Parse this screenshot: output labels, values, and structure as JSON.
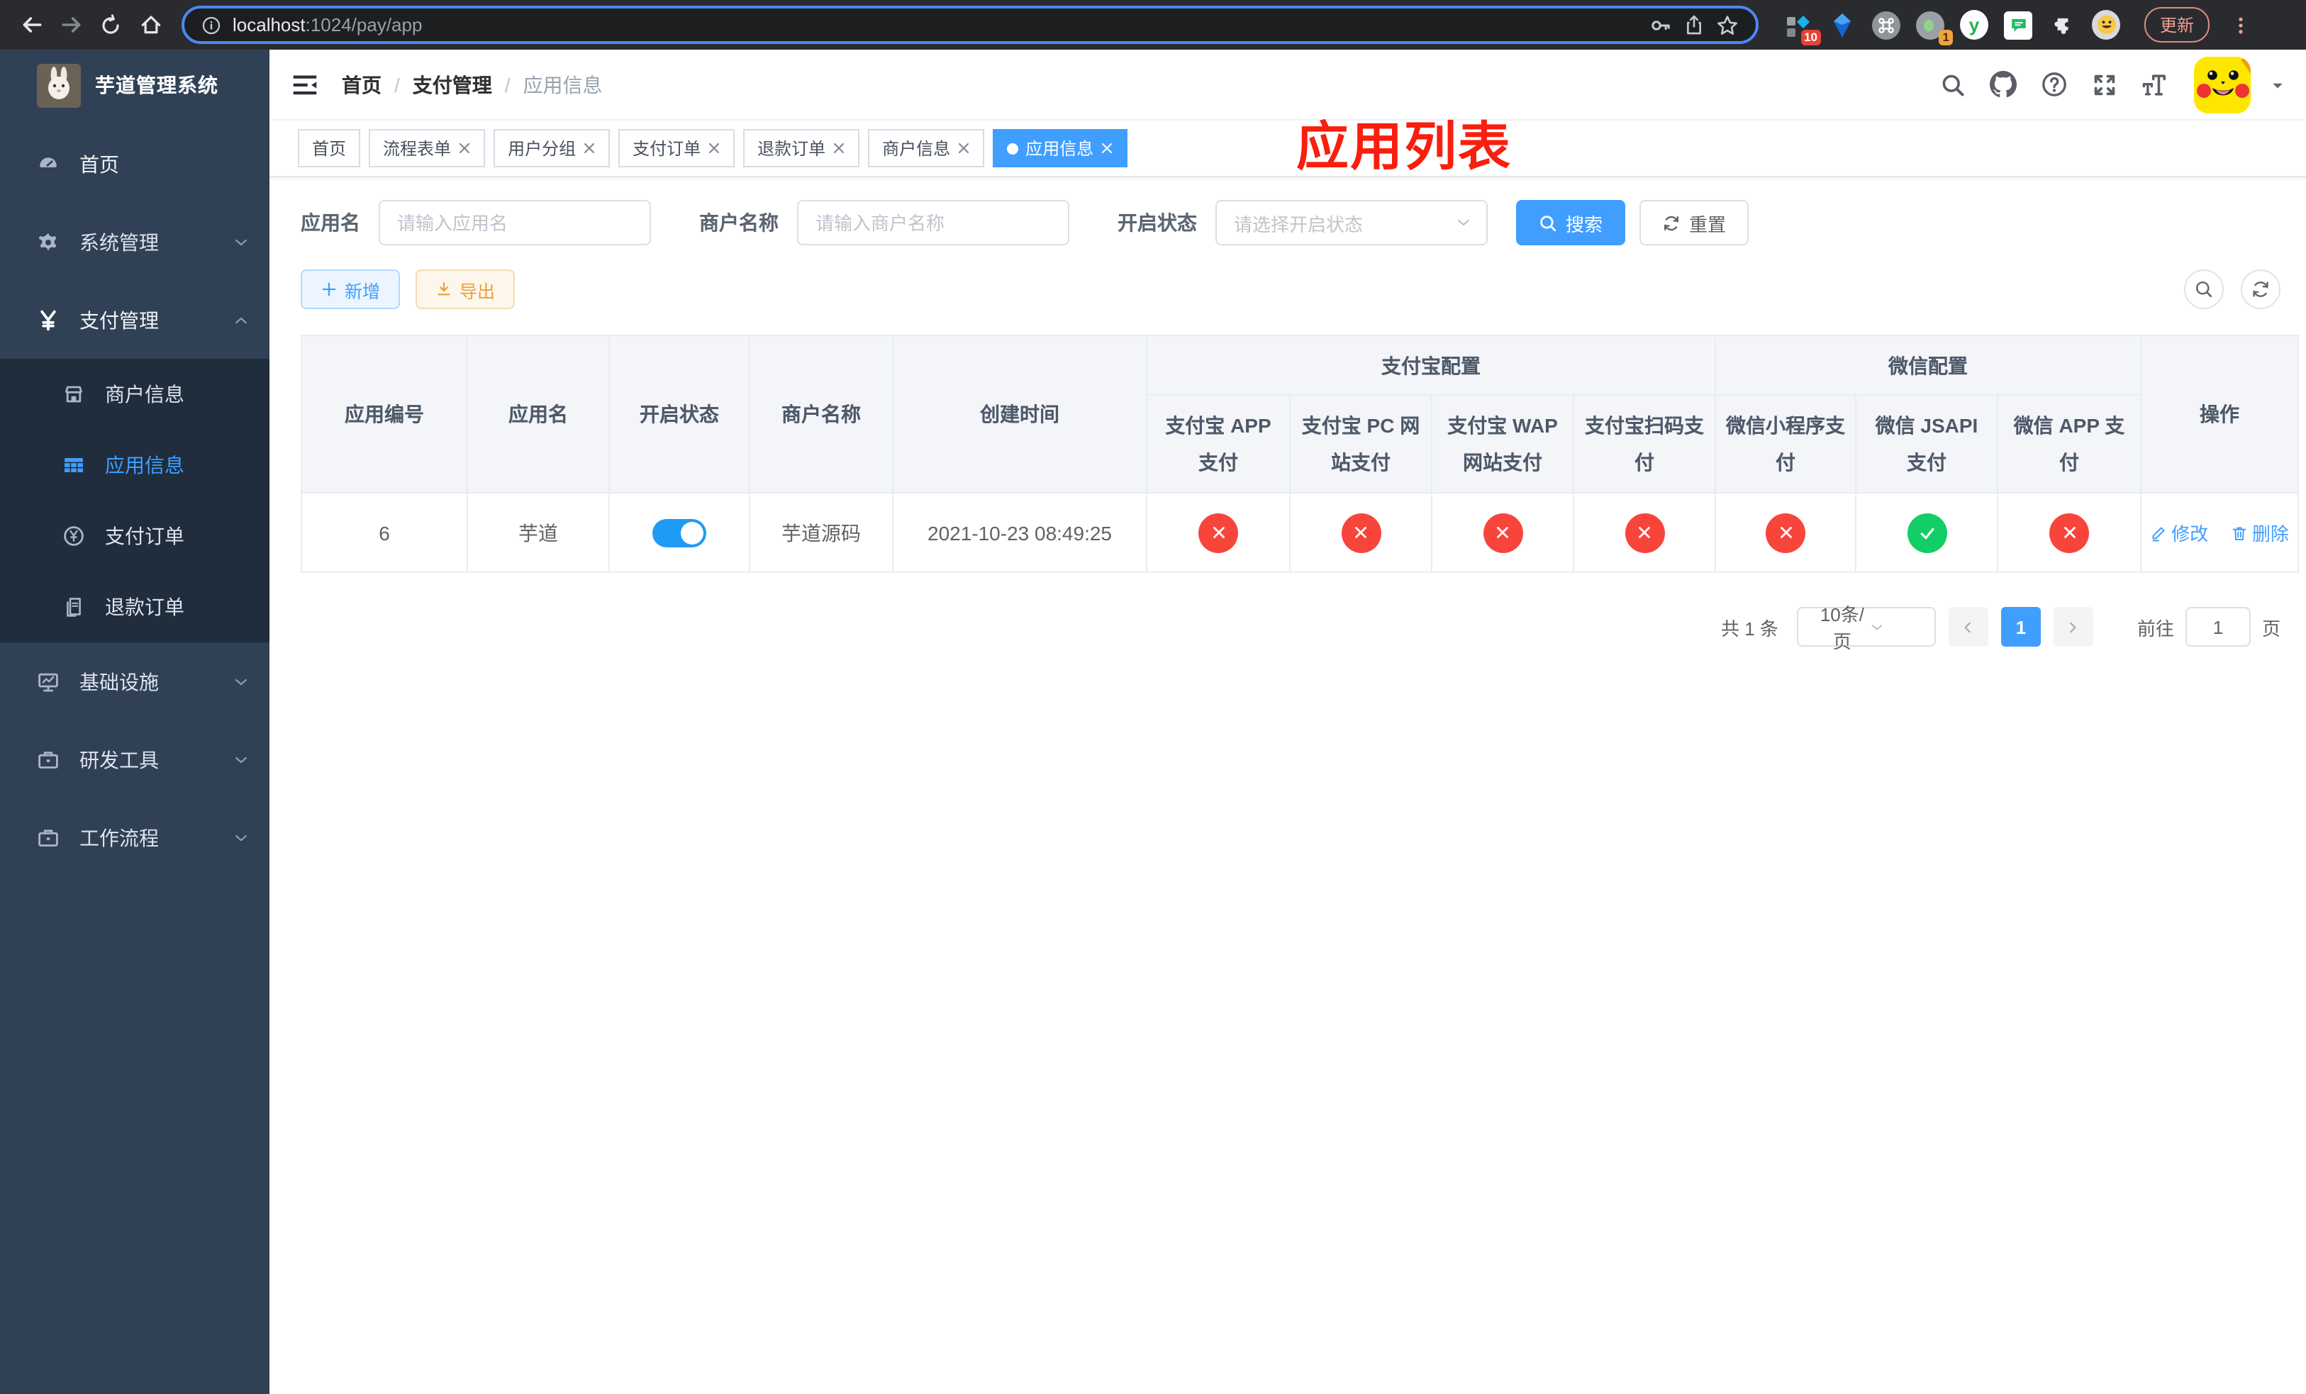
{
  "colors": {
    "primary": "#409eff",
    "success": "#13ce66",
    "danger": "#f8453c",
    "warning": "#e6a23c",
    "annotation_red": "#f91e0e",
    "sidebar_bg": "#304156",
    "submenu_bg": "#1f2d3d"
  },
  "browser": {
    "url_host": "localhost",
    "url_path": ":1024/pay/app",
    "update_label": "更新",
    "ext_badge_a": "10",
    "ext_badge_b": "1",
    "ext_y_label": "y"
  },
  "sidebar": {
    "title": "芋道管理系统",
    "items": [
      {
        "label": "首页",
        "icon": "dashboard-icon"
      },
      {
        "label": "系统管理",
        "icon": "gear-icon",
        "chevron": "down"
      },
      {
        "label": "支付管理",
        "icon": "yen-icon",
        "chevron": "up",
        "expanded": true
      },
      {
        "label": "商户信息",
        "icon": "shop-icon",
        "sub": true
      },
      {
        "label": "应用信息",
        "icon": "grid-icon",
        "sub": true,
        "active": true
      },
      {
        "label": "支付订单",
        "icon": "yen-circle-icon",
        "sub": true
      },
      {
        "label": "退款订单",
        "icon": "document-icon",
        "sub": true
      },
      {
        "label": "基础设施",
        "icon": "monitor-icon",
        "chevron": "down"
      },
      {
        "label": "研发工具",
        "icon": "toolbox-icon",
        "chevron": "down"
      },
      {
        "label": "工作流程",
        "icon": "toolbox-icon",
        "chevron": "down"
      }
    ]
  },
  "navbar": {
    "breadcrumb": [
      "首页",
      "支付管理",
      "应用信息"
    ],
    "annotation_title": "应用列表"
  },
  "tabs": [
    {
      "label": "首页",
      "closable": false,
      "active": false
    },
    {
      "label": "流程表单",
      "closable": true,
      "active": false
    },
    {
      "label": "用户分组",
      "closable": true,
      "active": false
    },
    {
      "label": "支付订单",
      "closable": true,
      "active": false
    },
    {
      "label": "退款订单",
      "closable": true,
      "active": false
    },
    {
      "label": "商户信息",
      "closable": true,
      "active": false
    },
    {
      "label": "应用信息",
      "closable": true,
      "active": true
    }
  ],
  "filters": {
    "app_name_label": "应用名",
    "app_name_placeholder": "请输入应用名",
    "merchant_label": "商户名称",
    "merchant_placeholder": "请输入商户名称",
    "status_label": "开启状态",
    "status_placeholder": "请选择开启状态",
    "search_label": "搜索",
    "reset_label": "重置"
  },
  "toolbar": {
    "add_label": "新增",
    "export_label": "导出"
  },
  "table": {
    "columns": [
      "应用编号",
      "应用名",
      "开启状态",
      "商户名称",
      "创建时间"
    ],
    "group_alipay": "支付宝配置",
    "group_wechat": "微信配置",
    "action_column": "操作",
    "pay_columns": [
      "支付宝 APP 支付",
      "支付宝 PC 网站支付",
      "支付宝 WAP 网站支付",
      "支付宝扫码支付",
      "微信小程序支付",
      "微信 JSAPI 支付",
      "微信 APP 支付"
    ],
    "row": {
      "id": "6",
      "name": "芋道",
      "enabled": true,
      "merchant": "芋道源码",
      "created_at": "2021-10-23 08:49:25",
      "pay_status": [
        false,
        false,
        false,
        false,
        false,
        true,
        false
      ],
      "edit_label": "修改",
      "delete_label": "删除"
    }
  },
  "pagination": {
    "total_text": "共 1 条",
    "page_size": "10条/页",
    "current_page": "1",
    "goto_label": "前往",
    "goto_value": "1",
    "page_suffix": "页"
  }
}
